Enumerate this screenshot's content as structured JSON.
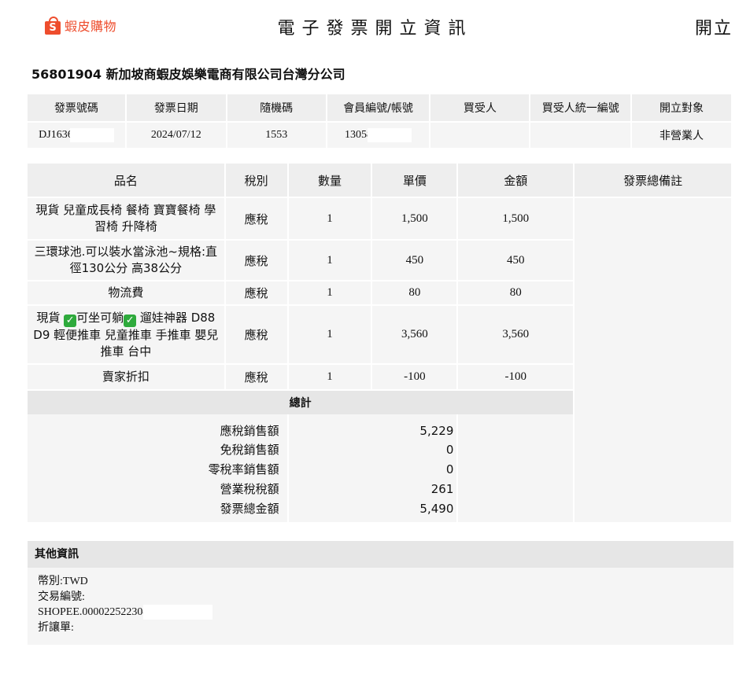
{
  "header": {
    "logo_text": "蝦皮購物",
    "logo_glyph": "S",
    "title": "電子發票開立資訊",
    "status": "開立"
  },
  "seller": "56801904 新加坡商蝦皮娛樂電商有限公司台灣分公司",
  "info": {
    "headers": [
      "發票號碼",
      "發票日期",
      "隨機碼",
      "會員編號/帳號",
      "買受人",
      "買受人統一編號",
      "開立對象"
    ],
    "invoice_no": "DJ1636",
    "invoice_date": "2024/07/12",
    "random_code": "1553",
    "member_id": "13058",
    "buyer": "",
    "buyer_tax_id": "",
    "target": "非營業人"
  },
  "items": {
    "headers": [
      "品名",
      "稅別",
      "數量",
      "單價",
      "金額",
      "發票總備註"
    ],
    "rows": [
      {
        "name": "現貨 兒童成長椅 餐椅 寶寶餐椅 學習椅 升降椅",
        "tax": "應稅",
        "qty": "1",
        "price": "1,500",
        "amount": "1,500"
      },
      {
        "name": "三環球池.可以裝水當泳池~規格:直徑130公分 高38公分",
        "tax": "應稅",
        "qty": "1",
        "price": "450",
        "amount": "450"
      },
      {
        "name": "物流費",
        "tax": "應稅",
        "qty": "1",
        "price": "80",
        "amount": "80"
      },
      {
        "name_parts": [
          "現貨 ",
          "可坐可躺",
          " 遛娃神器 D88 D9 輕便推車 兒童推車 手推車 嬰兒推車 台中"
        ],
        "tax": "應稅",
        "qty": "1",
        "price": "3,560",
        "amount": "3,560"
      },
      {
        "name": "賣家折扣",
        "tax": "應稅",
        "qty": "1",
        "price": "-100",
        "amount": "-100"
      }
    ],
    "check_icon": "✓",
    "total_label": "總計",
    "summary": [
      {
        "label": "應稅銷售額",
        "value": "5,229"
      },
      {
        "label": "免稅銷售額",
        "value": "0"
      },
      {
        "label": "零稅率銷售額",
        "value": "0"
      },
      {
        "label": "營業稅稅額",
        "value": "261"
      },
      {
        "label": "發票總金額",
        "value": "5,490"
      }
    ]
  },
  "other": {
    "title": "其他資訊",
    "currency": "幣別:TWD",
    "txn_label": "交易編號:",
    "txn_value": "SHOPEE.000022522304",
    "credit_note": "折讓單:"
  },
  "colors": {
    "brand": "#ee4d2d",
    "header_bg": "#eeeeee",
    "cell_bg": "#f5f5f5",
    "check_green": "#2eaa3c"
  }
}
